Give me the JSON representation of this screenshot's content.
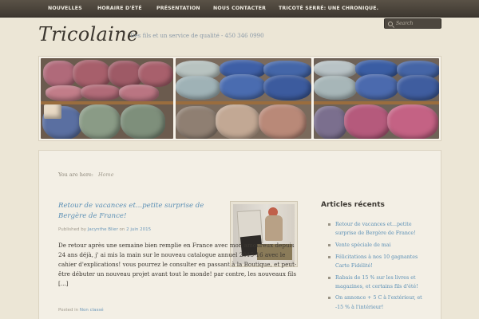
{
  "nav": {
    "items": [
      "NOUVELLES",
      "HORAIRE D'ÉTÉ",
      "PRÉSENTATION",
      "NOUS CONTACTER",
      "TRICOTÉ SERRÉ: UNE CHRONIQUE."
    ]
  },
  "header": {
    "title": "Tricolaine",
    "tagline": "Des fils et un service de qualité - 450 346 0990"
  },
  "search": {
    "placeholder": "Search"
  },
  "breadcrumb": {
    "prefix": "You are here:",
    "home": "Home"
  },
  "post": {
    "title": "Retour de vacances et...petite surprise de Bergère de France!",
    "meta_prefix": "Published by",
    "author": "Jacynthe Blier",
    "meta_on": "on",
    "date": "2 juin 2015",
    "body": "De retour après une semaine bien remplie en France avec mon amoureux depuis 24 ans déjà, j' ai mis la main sur le nouveau catalogue annuel 2015-16 avec le cahier d'explications! vous pourrez le consulter en passant à la Boutique, et peut-être débuter un nouveau projet avant tout le monde! par contre, les nouveaux fils [...]",
    "footer_prefix": "Posted in",
    "category": "Non classé"
  },
  "sidebar": {
    "title": "Articles récents",
    "items": [
      "Retour de vacances et...petite surprise de Bergère de France!",
      "Vente spéciale de mai",
      "Félicitations à nos 10 gagnantes Carte Fidélité!",
      "Rabais de 15 % sur les livres et magazines, et certains fils d'été!",
      "On annonce + 5 C à l'extérieur, et -15 % à l'intérieur!"
    ]
  },
  "colors": {
    "nav_bg": "#4a443b",
    "link": "#5a8fb5",
    "page_bg": "#ece6d6"
  }
}
